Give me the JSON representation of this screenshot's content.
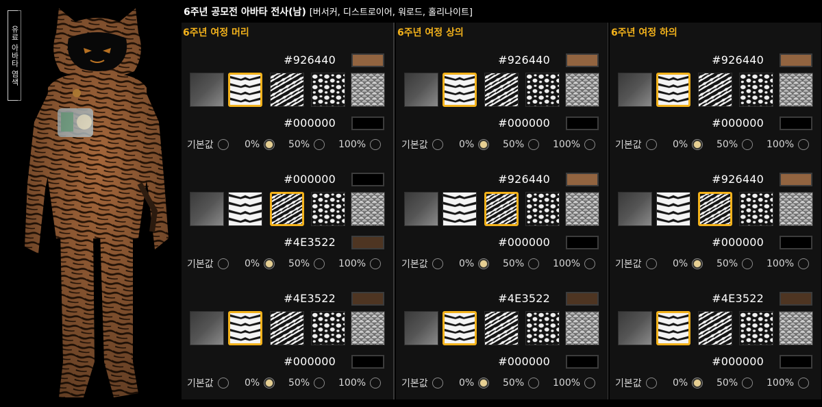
{
  "title": {
    "main": "6주년 공모전 아바타 전사(남)",
    "sub": "[버서커, 디스트로이어, 워로드, 홀리나이트]"
  },
  "side_label": "유료 아바타 염색",
  "radio_labels": [
    "기본값",
    "0%",
    "50%",
    "100%"
  ],
  "colors": {
    "accent": "#f3b21b",
    "panel": "#121212",
    "background": "#000000"
  },
  "columns": [
    {
      "header": "6주년 여정 머리",
      "groups": [
        {
          "hex1": "#926440",
          "color1": "#926440",
          "selected_pattern": 1,
          "hex2": "#000000",
          "color2": "#000000",
          "selected_radio": 1
        },
        {
          "hex1": "#000000",
          "color1": "#000000",
          "selected_pattern": 2,
          "hex2": "#4E3522",
          "color2": "#4E3522",
          "selected_radio": 1
        },
        {
          "hex1": "#4E3522",
          "color1": "#4E3522",
          "selected_pattern": 1,
          "hex2": "#000000",
          "color2": "#000000",
          "selected_radio": 1
        }
      ]
    },
    {
      "header": "6주년 여정 상의",
      "groups": [
        {
          "hex1": "#926440",
          "color1": "#926440",
          "selected_pattern": 1,
          "hex2": "#000000",
          "color2": "#000000",
          "selected_radio": 1
        },
        {
          "hex1": "#926440",
          "color1": "#926440",
          "selected_pattern": 2,
          "hex2": "#000000",
          "color2": "#000000",
          "selected_radio": 1
        },
        {
          "hex1": "#4E3522",
          "color1": "#4E3522",
          "selected_pattern": 1,
          "hex2": "#000000",
          "color2": "#000000",
          "selected_radio": 1
        }
      ]
    },
    {
      "header": "6주년 여정 하의",
      "groups": [
        {
          "hex1": "#926440",
          "color1": "#926440",
          "selected_pattern": 1,
          "hex2": "#000000",
          "color2": "#000000",
          "selected_radio": 1
        },
        {
          "hex1": "#926440",
          "color1": "#926440",
          "selected_pattern": 2,
          "hex2": "#000000",
          "color2": "#000000",
          "selected_radio": 1
        },
        {
          "hex1": "#4E3522",
          "color1": "#4E3522",
          "selected_pattern": 1,
          "hex2": "#000000",
          "color2": "#000000",
          "selected_radio": 1
        }
      ]
    }
  ],
  "patterns": [
    "gradient",
    "zebra-chevron",
    "zebra-diagonal",
    "leopard",
    "scale"
  ]
}
